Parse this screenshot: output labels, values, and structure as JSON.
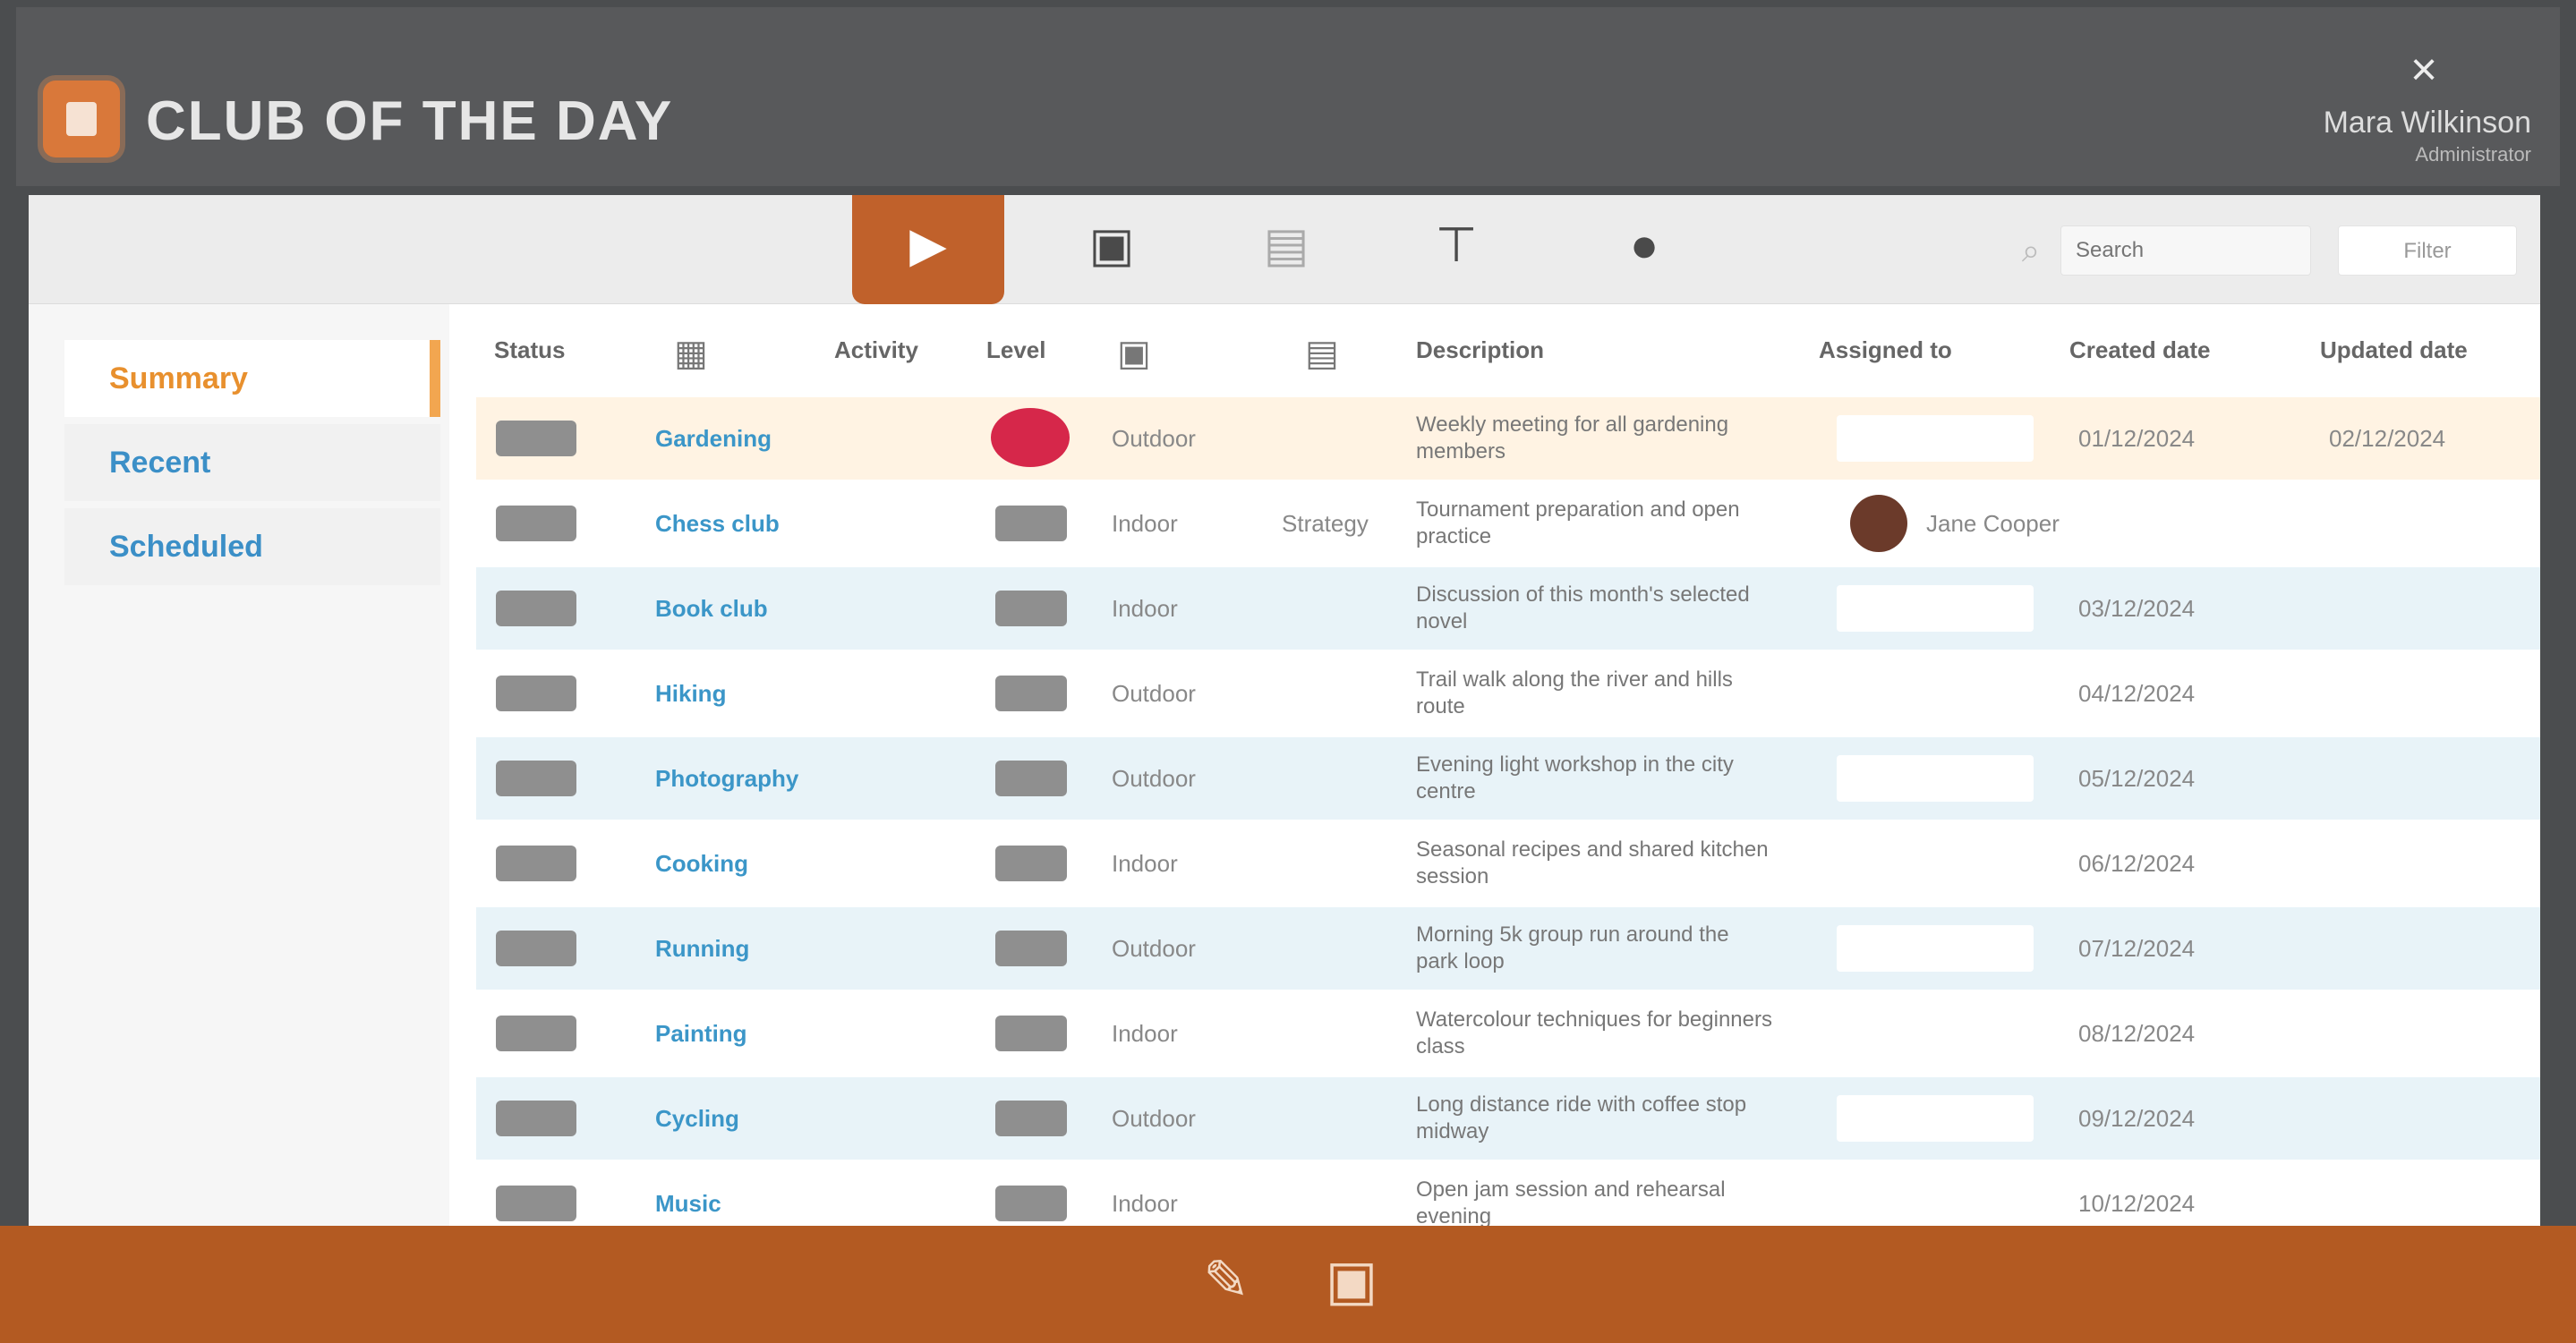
{
  "titlebar": {
    "title": "CLUB OF THE DAY",
    "user_name": "Mara Wilkinson",
    "user_sub": "Administrator",
    "close_glyph": "×"
  },
  "toolbar": {
    "tools": [
      {
        "icon": "play-icon",
        "glyph": "▶",
        "caption": ""
      },
      {
        "icon": "image-icon",
        "glyph": "▣",
        "caption": ""
      },
      {
        "icon": "document-icon",
        "glyph": "▤",
        "caption": ""
      },
      {
        "icon": "pin-icon",
        "glyph": "⊤",
        "caption": ""
      },
      {
        "icon": "user-icon",
        "glyph": "●",
        "caption": ""
      }
    ],
    "search_placeholder": "Search",
    "search_glyph": "⌕",
    "action_label": "Filter"
  },
  "sidebar": {
    "items": [
      {
        "label": "Summary",
        "state": "active"
      },
      {
        "label": "Recent",
        "state": "normal"
      },
      {
        "label": "Scheduled",
        "state": "normal"
      }
    ]
  },
  "table": {
    "headers": {
      "status": "Status",
      "club": "",
      "mood": "Activity",
      "level": "Level",
      "name": "",
      "type": "",
      "description": "Description",
      "assigned": "Assigned to",
      "created": "Created date",
      "updated": "Updated date"
    },
    "header_icons": {
      "club_icon": "▦",
      "name_icon": "▣",
      "type_icon": "▤"
    },
    "rows": [
      {
        "club": "Gardening",
        "name": "Outdoor",
        "type": "",
        "desc": "Weekly meeting for all gardening members",
        "assigned": "",
        "created": "01/12/2024",
        "updated": "02/12/2024",
        "flag": "red"
      },
      {
        "club": "Chess club",
        "name": "Indoor",
        "type": "Strategy",
        "desc": "Tournament preparation and open practice",
        "assigned": "Jane Cooper",
        "created": "",
        "updated": "",
        "flag": ""
      },
      {
        "club": "Book club",
        "name": "Indoor",
        "type": "",
        "desc": "Discussion of this month's selected novel",
        "assigned": "",
        "created": "03/12/2024",
        "updated": "",
        "flag": ""
      },
      {
        "club": "Hiking",
        "name": "Outdoor",
        "type": "",
        "desc": "Trail walk along the river and hills route",
        "assigned": "",
        "created": "04/12/2024",
        "updated": "",
        "flag": ""
      },
      {
        "club": "Photography",
        "name": "Outdoor",
        "type": "",
        "desc": "Evening light workshop in the city centre",
        "assigned": "",
        "created": "05/12/2024",
        "updated": "",
        "flag": ""
      },
      {
        "club": "Cooking",
        "name": "Indoor",
        "type": "",
        "desc": "Seasonal recipes and shared kitchen session",
        "assigned": "",
        "created": "06/12/2024",
        "updated": "",
        "flag": ""
      },
      {
        "club": "Running",
        "name": "Outdoor",
        "type": "",
        "desc": "Morning 5k group run around the park loop",
        "assigned": "",
        "created": "07/12/2024",
        "updated": "",
        "flag": ""
      },
      {
        "club": "Painting",
        "name": "Indoor",
        "type": "",
        "desc": "Watercolour techniques for beginners class",
        "assigned": "",
        "created": "08/12/2024",
        "updated": "",
        "flag": ""
      },
      {
        "club": "Cycling",
        "name": "Outdoor",
        "type": "",
        "desc": "Long distance ride with coffee stop midway",
        "assigned": "",
        "created": "09/12/2024",
        "updated": "",
        "flag": ""
      },
      {
        "club": "Music",
        "name": "Indoor",
        "type": "",
        "desc": "Open jam session and rehearsal evening",
        "assigned": "",
        "created": "10/12/2024",
        "updated": "",
        "flag": ""
      }
    ]
  },
  "footer": {
    "buttons": [
      {
        "icon": "edit-icon",
        "glyph": "✎"
      },
      {
        "icon": "save-icon",
        "glyph": "▣"
      }
    ]
  },
  "colors": {
    "accent": "#c0612b",
    "footer": "#b35a22",
    "link": "#3b96c8",
    "sidebar_active": "#e8902e",
    "row_alt": "#e8f3f8",
    "row_selected": "#fff3e3",
    "flag_red": "#d6274a"
  }
}
